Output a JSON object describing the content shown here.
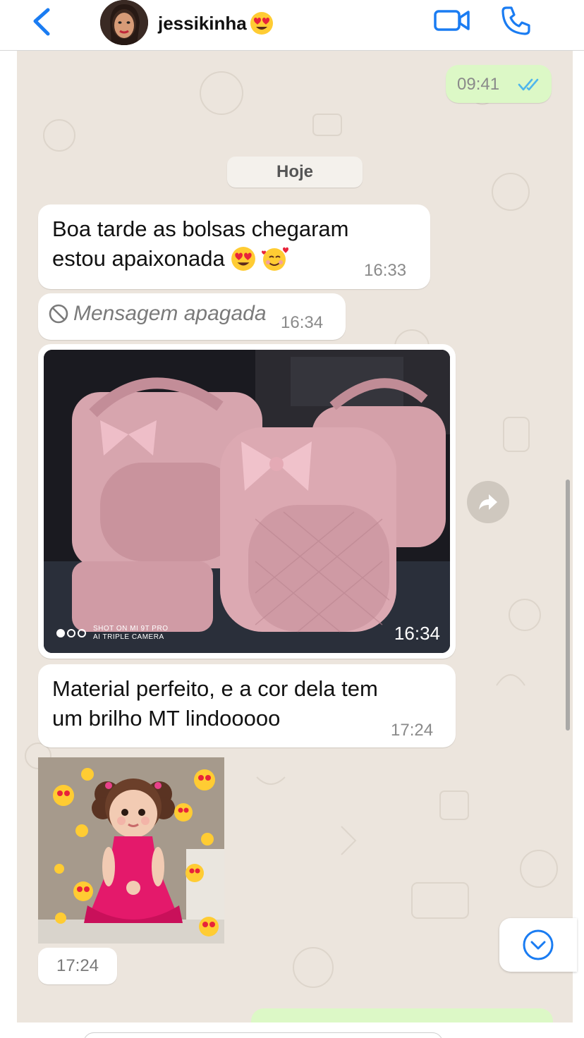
{
  "header": {
    "contact_name": "jessikinha",
    "name_emoji": "heart-eyes-emoji",
    "back_icon": "chevron-left-icon",
    "video_icon": "video-camera-icon",
    "phone_icon": "phone-icon",
    "accent": "#1a7cf2"
  },
  "chat": {
    "top_outgoing": {
      "time": "09:41",
      "status": "read",
      "tick_color": "#4fb6ec"
    },
    "day_separator": "Hoje",
    "msg1": {
      "text_line1": "Boa tarde as bolsas chegaram",
      "text_line2": "estou apaixonada",
      "emojis": [
        "heart-eyes-emoji",
        "smiling-face-with-hearts-emoji"
      ],
      "time": "16:33"
    },
    "deleted": {
      "text": "Mensagem apagada",
      "time": "16:34",
      "icon": "prohibited-icon"
    },
    "photo": {
      "time": "16:34",
      "watermark_line1": "SHOT ON MI 9T PRO",
      "watermark_line2": "AI TRIPLE CAMERA",
      "subject": "pink quilted baby bags"
    },
    "msg2": {
      "text_line1": "Material perfeito, e a cor dela tem",
      "text_line2": "um brilho MT lindooooo",
      "time": "17:24"
    },
    "sticker": {
      "subject": "baby in pink dress with heart-eyes emojis"
    },
    "sticker_time": "17:24"
  },
  "controls": {
    "forward_icon": "forward-arrow-icon",
    "scroll_down_icon": "chevron-down-circle-icon"
  },
  "colors": {
    "chat_bg": "#ece5dd",
    "outgoing_bubble": "#dcf8c6",
    "incoming_bubble": "#ffffff"
  }
}
